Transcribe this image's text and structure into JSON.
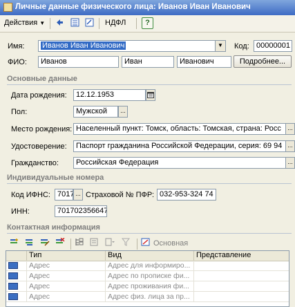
{
  "window": {
    "title": "Личные данные физического лица: Иванов Иван Иванович"
  },
  "toolbar": {
    "actions_label": "Действия",
    "ndfl_label": "НДФЛ",
    "help_label": "?"
  },
  "form": {
    "name_label": "Имя:",
    "name_value": "Иванов Иван Иванович",
    "code_label": "Код:",
    "code_value": "00000001",
    "fio_label": "ФИО:",
    "last_name": "Иванов",
    "first_name": "Иван",
    "middle_name": "Иванович",
    "details_button": "Подробнее..."
  },
  "basic": {
    "section_title": "Основные данные",
    "birth_label": "Дата рождения:",
    "birth_value": "12.12.1953",
    "sex_label": "Пол:",
    "sex_value": "Мужской",
    "birthplace_label": "Место рождения:",
    "birthplace_value": "Населенный пункт: Томск, область: Томская, страна: Росс",
    "id_label": "Удостоверение:",
    "id_value": "Паспорт гражданина Российской Федерации, серия: 69 94",
    "citizenship_label": "Гражданство:",
    "citizenship_value": "Российская Федерация"
  },
  "numbers": {
    "section_title": "Индивидуальные номера",
    "ifns_label": "Код ИФНС:",
    "ifns_value": "7017",
    "pfr_label": "Страховой № ПФР:",
    "pfr_value": "032-953-324 74",
    "inn_label": "ИНН:",
    "inn_value": "701702356647"
  },
  "contacts": {
    "section_title": "Контактная информация",
    "primary_label": "Основная",
    "columns": [
      "Тип",
      "Вид",
      "Представление"
    ],
    "rows": [
      {
        "type": "Адрес",
        "kind": "Адрес для информиро...",
        "view": ""
      },
      {
        "type": "Адрес",
        "kind": "Адрес по прописке фи...",
        "view": ""
      },
      {
        "type": "Адрес",
        "kind": "Адрес проживания фи...",
        "view": ""
      },
      {
        "type": "Адрес",
        "kind": "Адрес физ. лица за пр...",
        "view": ""
      }
    ]
  },
  "colors": {
    "titlebar": "#3d6bc4",
    "selection": "#316ac5",
    "section_text": "#7d7d7d"
  }
}
